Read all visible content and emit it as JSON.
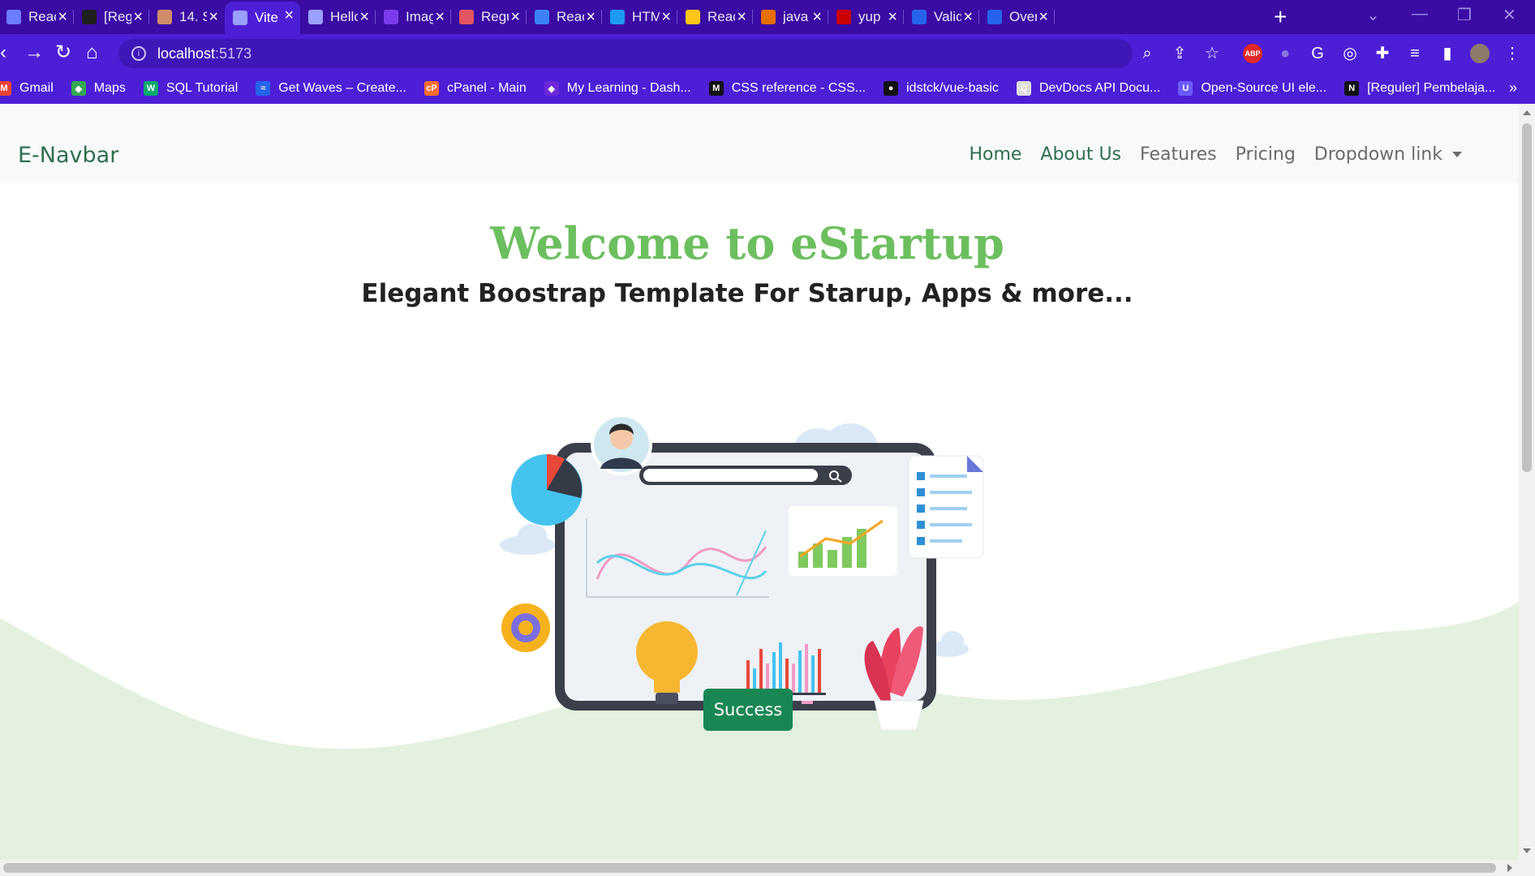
{
  "browser": {
    "tabs": [
      {
        "title": "Reac",
        "icon": "maven-icon",
        "color": "#6b7cff"
      },
      {
        "title": "[Reg",
        "icon": "notion-icon",
        "color": "#1f1f1f"
      },
      {
        "title": "14. S",
        "icon": "book-icon",
        "color": "#d08c6a"
      },
      {
        "title": "Vite",
        "icon": "globe-icon",
        "color": "#9aa0ff"
      },
      {
        "title": "Hello",
        "icon": "globe-icon",
        "color": "#9aa0ff"
      },
      {
        "title": "Imag",
        "icon": "bootstrap-icon",
        "color": "#7c3aed"
      },
      {
        "title": "Regu",
        "icon": "flask-icon",
        "color": "#e25561"
      },
      {
        "title": "Reac",
        "icon": "doc-icon",
        "color": "#3b82f6"
      },
      {
        "title": "HTM",
        "icon": "web-icon",
        "color": "#1d9bf0"
      },
      {
        "title": "Reac",
        "icon": "vite-icon",
        "color": "#ffc517"
      },
      {
        "title": "java",
        "icon": "java-icon",
        "color": "#e76f00"
      },
      {
        "title": "yup",
        "icon": "npm-icon",
        "color": "#cb0000"
      },
      {
        "title": "Valid",
        "icon": "hex-icon",
        "color": "#2563eb"
      },
      {
        "title": "Over",
        "icon": "hex-icon",
        "color": "#2563eb"
      }
    ],
    "url_host": "localhost",
    "url_port": ":5173",
    "bookmarks": [
      {
        "label": "Gmail",
        "color": "#ea4335",
        "glyph": "M"
      },
      {
        "label": "Maps",
        "color": "#34a853",
        "glyph": "◆"
      },
      {
        "label": "SQL Tutorial",
        "color": "#04aa6d",
        "glyph": "W"
      },
      {
        "label": "Get Waves – Create...",
        "color": "#2563eb",
        "glyph": "≈"
      },
      {
        "label": "cPanel - Main",
        "color": "#ff6c2c",
        "glyph": "cP"
      },
      {
        "label": "My Learning - Dash...",
        "color": "#6d28d9",
        "glyph": "◈"
      },
      {
        "label": "CSS reference - CSS...",
        "color": "#111111",
        "glyph": "M"
      },
      {
        "label": "idstck/vue-basic",
        "color": "#111111",
        "glyph": "●"
      },
      {
        "label": "DevDocs API Docu...",
        "color": "#dddddd",
        "glyph": "Q"
      },
      {
        "label": "Open-Source UI ele...",
        "color": "#6b5bff",
        "glyph": "U"
      },
      {
        "label": "[Reguler] Pembelaja...",
        "color": "#111111",
        "glyph": "N"
      }
    ],
    "more": "»"
  },
  "site": {
    "brand": "E-Navbar",
    "nav": [
      {
        "label": "Home",
        "active": true
      },
      {
        "label": "About Us",
        "active": true
      },
      {
        "label": "Features",
        "active": false
      },
      {
        "label": "Pricing",
        "active": false
      },
      {
        "label": "Dropdown link",
        "active": false,
        "dropdown": true
      }
    ],
    "hero_title": "Welcome to eStartup",
    "hero_subtitle": "Elegant Boostrap Template For Starup, Apps & more...",
    "cta_label": "Success"
  },
  "colors": {
    "chrome_dark": "#3a0ca3",
    "chrome": "#4c1fd6",
    "brand_green": "#2f6f4f",
    "hero_green": "#6cbf5e",
    "wave_green": "#e3f1de",
    "button_green": "#198754"
  }
}
